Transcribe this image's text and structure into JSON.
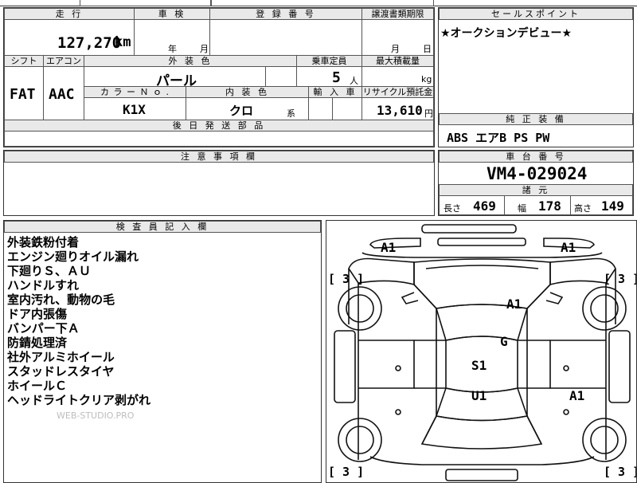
{
  "top_cut": {
    "text1": "",
    "text2": ""
  },
  "mileage": {
    "header": "走 行",
    "value": "127,270",
    "unit": "km"
  },
  "inspection": {
    "header": "車 検",
    "year_unit": "年",
    "month_unit": "月"
  },
  "registration": {
    "header": "登 録 番 号"
  },
  "transfer_docs": {
    "header": "譲渡書類期限",
    "month_unit": "月",
    "day_unit": "日"
  },
  "sales_point": {
    "header": "セールスポイント",
    "text": "★オークションデビュー★"
  },
  "shift": {
    "header": "シフト",
    "value": "FAT"
  },
  "aircon": {
    "header": "エアコン",
    "value": "AAC"
  },
  "exterior_color": {
    "header": "外 装 色",
    "value": "パール"
  },
  "capacity": {
    "header": "乗車定員",
    "value": "5",
    "unit": "人"
  },
  "max_load": {
    "header": "最大積載量",
    "unit": "kg"
  },
  "color_no": {
    "header": "カ ラ ー Ｎ ｏ .",
    "value": "K1X"
  },
  "interior_color": {
    "header": "内 装 色",
    "value": "クロ",
    "unit": "系"
  },
  "import": {
    "header": "輸 入 車"
  },
  "recycle_fee": {
    "header": "リサイクル預託金",
    "value": "13,610",
    "unit": "円"
  },
  "later_parts": {
    "header": "後 日 発 送 部 品"
  },
  "standard_equipment": {
    "header": "純 正 装 備",
    "value": "ABS エアB PS PW"
  },
  "notes": {
    "header": "注 意 事 項 欄"
  },
  "chassis": {
    "header": "車 台 番 号",
    "value": "VM4-029024"
  },
  "dimensions": {
    "header": "諸 元",
    "length_label": "長さ",
    "length": "469",
    "width_label": "幅",
    "width": "178",
    "height_label": "高さ",
    "height": "149"
  },
  "inspector_notes": {
    "header": "検 査 員 記 入 欄",
    "items": [
      "外装鉄粉付着",
      "エンジン廻りオイル漏れ",
      "下廻りＳ、ＡＵ",
      "ハンドルすれ",
      "室内汚れ、動物の毛",
      "ドア内張傷",
      "バンパー下Ａ",
      "防錆処理済",
      "社外アルミホイール",
      "スタッドレスタイヤ",
      "ホイールＣ",
      "ヘッドライトクリア剥がれ"
    ],
    "watermark": "WEB-STUDIO.PRO"
  },
  "diagram": {
    "marks": {
      "front_left": "A1",
      "front_right": "A1",
      "hood": "A1",
      "windshield": "G",
      "roof": "S1",
      "rear_glass": "U1",
      "right_rear": "A1"
    },
    "tire_labels": [
      "[ 3 ]",
      "[ 3 ]",
      "[ 3 ]",
      "[ 3 ]"
    ]
  }
}
